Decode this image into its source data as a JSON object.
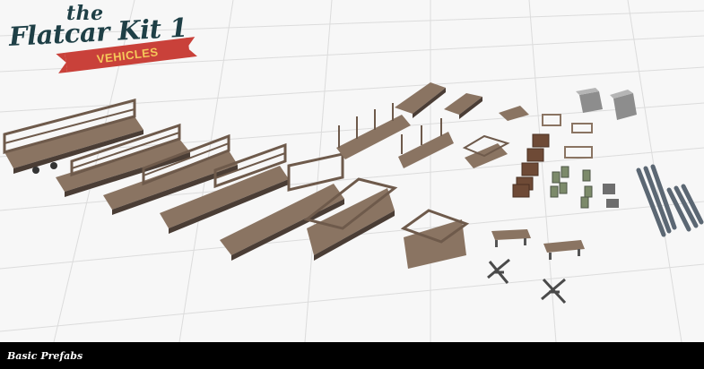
{
  "logo": {
    "prefix": "the",
    "title": "Flatcar Kit 1",
    "ribbon": "VEHICLES"
  },
  "footer": {
    "caption": "Basic Prefabs"
  },
  "colors": {
    "logo_text": "#1e3f46",
    "ribbon": "#c9413a",
    "ribbon_text": "#f5c85a",
    "wood": "#8a7462",
    "wood_dark": "#5e4d41",
    "grid": "#d8d8d8"
  }
}
